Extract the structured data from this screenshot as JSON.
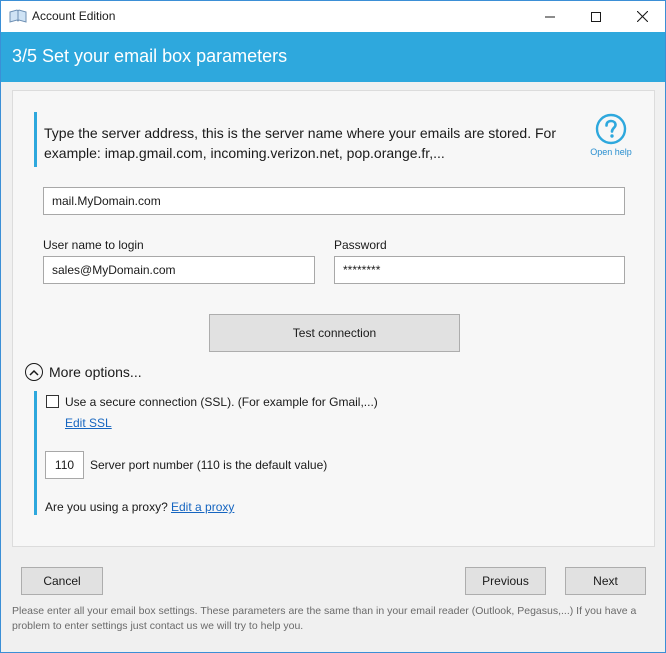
{
  "window": {
    "title": "Account Edition",
    "controls": {
      "minimize": "—",
      "maximize": "☐",
      "close": "✕"
    }
  },
  "header": {
    "title": "3/5  Set your email box parameters"
  },
  "info": {
    "text": "Type the server address, this is the server name where your emails are stored. For example: imap.gmail.com, incoming.verizon.net, pop.orange.fr,...",
    "help_label": "Open help",
    "help_icon": "question-circle-icon"
  },
  "form": {
    "server_value": "mail.MyDomain.com",
    "username_label": "User name to login",
    "username_value": "sales@MyDomain.com",
    "password_label": "Password",
    "password_value": "********",
    "test_button": "Test connection"
  },
  "options": {
    "toggle_label": "More options...",
    "toggle_icon": "chevron-up-circle-icon",
    "ssl_checked": false,
    "ssl_label": "Use a secure connection (SSL). (For example for Gmail,...)",
    "edit_ssl": "Edit SSL",
    "port_value": "110",
    "port_label": "Server port number (110 is the default value)",
    "proxy_question": "Are you using a proxy?",
    "edit_proxy": "Edit a proxy"
  },
  "buttons": {
    "cancel": "Cancel",
    "previous": "Previous",
    "next": "Next"
  },
  "footer": {
    "note": "Please enter all your email box settings. These parameters are the same than in your email reader (Outlook, Pegasus,...) If you have a problem to enter settings just contact us we will try to help you."
  },
  "colors": {
    "accent": "#2ea8dd",
    "link": "#1565c0"
  }
}
